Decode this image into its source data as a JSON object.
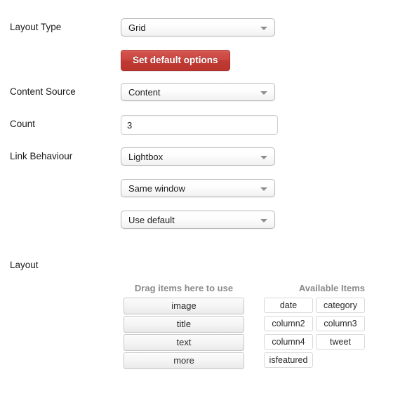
{
  "fields": [
    {
      "label": "Layout Type",
      "control": "select",
      "value": "Grid",
      "name": "layout-type"
    },
    {
      "label": "Content Source",
      "control": "select",
      "value": "Content",
      "name": "content-source"
    },
    {
      "label": "Count",
      "control": "text",
      "value": "3",
      "placeholder": "",
      "name": "count"
    },
    {
      "label": "Link Behaviour",
      "control": "select",
      "value": "Lightbox",
      "name": "link-behaviour"
    },
    {
      "label": "",
      "control": "select",
      "value": "Same window",
      "name": "link-target"
    },
    {
      "label": "",
      "control": "select",
      "value": "Use default",
      "name": "link-default"
    }
  ],
  "buttons": {
    "set_default_options": "Set default options"
  },
  "layout_section": {
    "label": "Layout",
    "dropzone_header": "Drag items here to use",
    "available_header": "Available Items",
    "dropzone_items": [
      "image",
      "title",
      "text",
      "more"
    ],
    "available_items": [
      "date",
      "category",
      "column2",
      "column3",
      "column4",
      "tweet",
      "isfeatured"
    ]
  },
  "icons": {
    "dropdown_arrow": "chevron-down-icon"
  },
  "colors": {
    "button_red": "#c03a34",
    "header_gray": "#8a8a8a",
    "label_text": "#1a1a1a"
  }
}
